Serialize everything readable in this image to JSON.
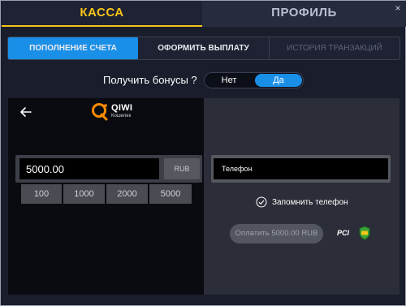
{
  "header": {
    "tabs": [
      {
        "label": "КАССА",
        "active": true
      },
      {
        "label": "ПРОФИЛЬ",
        "active": false
      }
    ],
    "close_icon": "close-icon",
    "accent_color": "#f5c518"
  },
  "subtabs": [
    {
      "label": "ПОПОЛНЕНИЕ СЧЕТА",
      "active": true
    },
    {
      "label": "ОФОРМИТЬ ВЫПЛАТУ",
      "active": false
    },
    {
      "label": "ИСТОРИЯ ТРАНЗАКЦИЙ",
      "active": false,
      "disabled": true
    }
  ],
  "bonus": {
    "label": "Получить бонусы ?",
    "options": [
      "Нет",
      "Да"
    ],
    "selected": "Да",
    "active_color": "#1a8fe8"
  },
  "payment_method": {
    "name": "QIWI",
    "subtitle": "Кошелек",
    "back_icon": "back-arrow-icon"
  },
  "deposit": {
    "amount": "5000.00",
    "currency": "RUB",
    "presets": [
      "100",
      "1000",
      "2000",
      "5000"
    ]
  },
  "phone": {
    "placeholder": "Телефон",
    "remember_label": "Запомнить телефон",
    "remember_icon": "check-circle-icon"
  },
  "pay": {
    "label": "Оплатить 5000.00 RUB",
    "badges": [
      {
        "icon": "pci-icon",
        "text": "PCI"
      },
      {
        "icon": "ssl-shield-icon"
      }
    ]
  }
}
